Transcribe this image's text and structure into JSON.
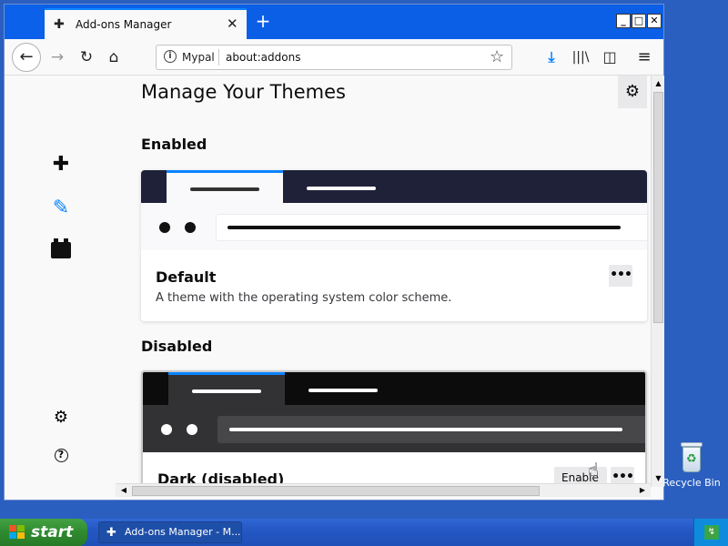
{
  "window": {
    "tab_title": "Add-ons Manager",
    "new_tab_symbol": "+",
    "close_tab_symbol": "✕",
    "controls": {
      "minimize": "_",
      "maximize": "□",
      "close": "✕"
    }
  },
  "navbar": {
    "identity_label": "Mypal",
    "url": "about:addons",
    "info_symbol": "i"
  },
  "sidebar": {
    "items": [
      {
        "name": "extensions",
        "icon": "puzzle-icon"
      },
      {
        "name": "themes",
        "icon": "brush-icon",
        "selected": true
      },
      {
        "name": "plugins",
        "icon": "plugin-block-icon"
      }
    ],
    "footer": [
      {
        "name": "addon-settings",
        "icon": "gear-icon"
      },
      {
        "name": "addon-support",
        "icon": "help-icon",
        "symbol": "?"
      }
    ]
  },
  "main": {
    "title": "Manage Your Themes",
    "enabled_heading": "Enabled",
    "disabled_heading": "Disabled",
    "themes": [
      {
        "name": "Default",
        "description": "A theme with the operating system color scheme.",
        "status": "enabled",
        "more_label": "•••"
      },
      {
        "name": "Dark (disabled)",
        "description": "",
        "status": "disabled",
        "enable_label": "Enable",
        "more_label": "•••"
      }
    ]
  },
  "desktop": {
    "recycle_bin_label": "Recycle Bin"
  },
  "taskbar": {
    "start_label": "start",
    "items": [
      {
        "label": "Add-ons Manager - M..."
      }
    ]
  },
  "colors": {
    "accent": "#0a84ff",
    "tabbar": "#0a5fe6",
    "desktop": "#2a5fc0",
    "start_button": "#2f8a2f"
  }
}
